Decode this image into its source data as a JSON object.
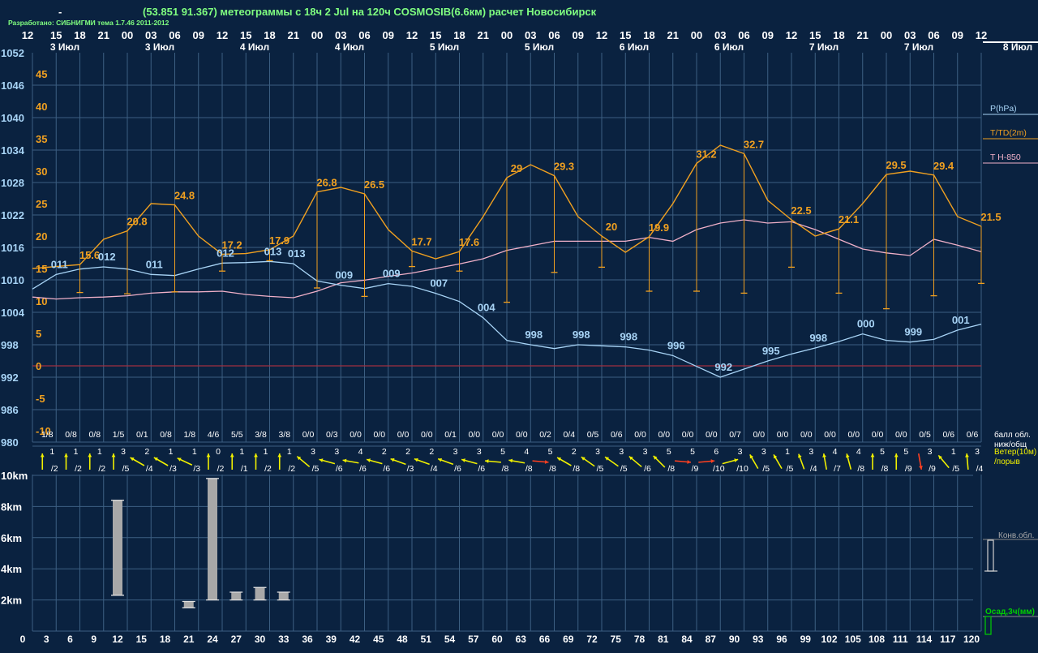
{
  "header": {
    "dash": "-",
    "title": "(53.851 91.367) метеограммы с  18ч 2 Jul на 120ч COSMOSIB(6.6км) расчет Новосибирск",
    "credit": "Разработано: СИБНИГМИ тема 1.7.46 2011-2012"
  },
  "colors": {
    "background": "#0a2240",
    "grid": "#3c5f82",
    "pressure": "#a8d4f6",
    "temperature": "#f0a020",
    "dewpoint_t850": "#f0b0c8",
    "zero_line": "#a03040",
    "wind_normal": "#f0f000",
    "wind_strong": "#ff4020",
    "cloud_bar": "#a8a8a8",
    "precip_legend": "#00d000",
    "text_white": "#ffffff",
    "title_green": "#80ff80"
  },
  "chart_data": {
    "type": "line",
    "hours_top": [
      "12",
      "15",
      "18",
      "21",
      "00",
      "03",
      "06",
      "09",
      "12",
      "15",
      "18",
      "21",
      "00",
      "03",
      "06",
      "09",
      "12",
      "15",
      "18",
      "21",
      "00",
      "03",
      "06",
      "09",
      "12",
      "15",
      "18",
      "21",
      "00",
      "03",
      "06",
      "09",
      "12",
      "15",
      "18",
      "21",
      "00",
      "03",
      "06",
      "09",
      "12"
    ],
    "day_labels": [
      "3 Июл",
      "3 Июл",
      "4 Июл",
      "4 Июл",
      "5 Июл",
      "5 Июл",
      "6 Июл",
      "6 Июл",
      "7 Июл",
      "7 Июл",
      "8 Июл"
    ],
    "forecast_hours": [
      "0",
      "3",
      "6",
      "9",
      "12",
      "15",
      "18",
      "21",
      "24",
      "27",
      "30",
      "33",
      "36",
      "39",
      "42",
      "45",
      "48",
      "51",
      "54",
      "57",
      "60",
      "63",
      "66",
      "69",
      "72",
      "75",
      "78",
      "81",
      "84",
      "87",
      "90",
      "93",
      "96",
      "99",
      "102",
      "105",
      "108",
      "111",
      "114",
      "117",
      "120"
    ],
    "pressure_axis_ticks": [
      "1052",
      "1046",
      "1040",
      "1034",
      "1028",
      "1022",
      "1016",
      "1010",
      "1004",
      "998",
      "992",
      "986",
      "980"
    ],
    "temp_axis_ticks": [
      "45",
      "40",
      "35",
      "30",
      "25",
      "20",
      "15",
      "10",
      "5",
      "0",
      "-5",
      "-10"
    ],
    "pressure_ylim": [
      980,
      1052
    ],
    "temp_ylim": [
      -10,
      48
    ],
    "series": [
      {
        "name": "P(hPa)",
        "values": [
          1008.3,
          1011,
          1012,
          1012.4,
          1012,
          1011,
          1010.8,
          1012,
          1013.1,
          1013.2,
          1013.4,
          1013,
          1009.8,
          1009,
          1008.4,
          1009.3,
          1008.8,
          1007.5,
          1006,
          1003,
          998.8,
          998,
          997.3,
          998,
          997.8,
          997.6,
          997,
          996,
          994,
          992,
          993.5,
          995,
          996.3,
          997.4,
          998.6,
          1000,
          998.8,
          998.5,
          999,
          1000.7,
          1001.8
        ]
      },
      {
        "name": "T/TD(2m)",
        "values": [
          15,
          15.3,
          15.6,
          19.5,
          20.8,
          25,
          24.8,
          20,
          17.2,
          17.3,
          17.9,
          20,
          26.8,
          27.5,
          26.5,
          21,
          17.7,
          16.5,
          17.6,
          23,
          29,
          31,
          29.3,
          23,
          20,
          17.5,
          19.9,
          25,
          31.2,
          34,
          32.7,
          25.5,
          22.5,
          20,
          21.1,
          25,
          29.5,
          30,
          29.4,
          23,
          21.5
        ]
      },
      {
        "name": "T H-850",
        "values": [
          10.6,
          10.3,
          10.5,
          10.6,
          10.8,
          11.2,
          11.4,
          11.4,
          11.5,
          11,
          10.7,
          10.5,
          11.5,
          12.8,
          13.2,
          13.8,
          14.3,
          15,
          15.7,
          16.5,
          17.8,
          18.5,
          19.2,
          19.2,
          19.2,
          19.2,
          19.8,
          19.2,
          21,
          22,
          22.5,
          22,
          22.2,
          21,
          19.5,
          18,
          17.4,
          17,
          19.5,
          18.6,
          17.6
        ]
      }
    ],
    "temp_point_labels": [
      {
        "i": 2,
        "text": "15.6"
      },
      {
        "i": 4,
        "text": "20.8"
      },
      {
        "i": 6,
        "text": "24.8"
      },
      {
        "i": 8,
        "text": "17.2"
      },
      {
        "i": 10,
        "text": "17.9"
      },
      {
        "i": 12,
        "text": "26.8"
      },
      {
        "i": 14,
        "text": "26.5"
      },
      {
        "i": 16,
        "text": "17.7"
      },
      {
        "i": 18,
        "text": "17.6"
      },
      {
        "i": 20,
        "text": "29"
      },
      {
        "i": 22,
        "text": "29.3"
      },
      {
        "i": 24,
        "text": "20"
      },
      {
        "i": 26,
        "text": "19.9"
      },
      {
        "i": 28,
        "text": "31.2"
      },
      {
        "i": 30,
        "text": "32.7"
      },
      {
        "i": 32,
        "text": "22.5"
      },
      {
        "i": 34,
        "text": "21.1"
      },
      {
        "i": 36,
        "text": "29.5"
      },
      {
        "i": 38,
        "text": "29.4"
      },
      {
        "i": 40,
        "text": "21.5"
      }
    ],
    "pressure_point_labels": [
      {
        "i": 1,
        "text": "011"
      },
      {
        "i": 3,
        "text": "012"
      },
      {
        "i": 5,
        "text": "011"
      },
      {
        "i": 8,
        "text": "012"
      },
      {
        "i": 10,
        "text": "013"
      },
      {
        "i": 11,
        "text": "013"
      },
      {
        "i": 13,
        "text": "009"
      },
      {
        "i": 15,
        "text": "009"
      },
      {
        "i": 17,
        "text": "007"
      },
      {
        "i": 19,
        "text": "004"
      },
      {
        "i": 21,
        "text": "998"
      },
      {
        "i": 23,
        "text": "998"
      },
      {
        "i": 25,
        "text": "998"
      },
      {
        "i": 27,
        "text": "996"
      },
      {
        "i": 29,
        "text": "992"
      },
      {
        "i": 31,
        "text": "995"
      },
      {
        "i": 33,
        "text": "998"
      },
      {
        "i": 35,
        "text": "000"
      },
      {
        "i": 37,
        "text": "999"
      },
      {
        "i": 39,
        "text": "001"
      }
    ],
    "td_whisker_bottom": [
      null,
      null,
      11.3,
      null,
      11.1,
      null,
      11.4,
      null,
      14.6,
      null,
      16.2,
      null,
      12,
      null,
      10.7,
      null,
      15.3,
      null,
      14.6,
      null,
      9.8,
      null,
      14.4,
      null,
      15.2,
      null,
      11.5,
      null,
      11.5,
      null,
      11.2,
      null,
      15.2,
      null,
      11.2,
      null,
      8.8,
      null,
      10.8,
      null,
      12.7
    ],
    "cloud_fractions": [
      "1/8",
      "0/8",
      "0/8",
      "1/5",
      "0/1",
      "0/8",
      "1/8",
      "4/6",
      "5/5",
      "3/8",
      "3/8",
      "0/0",
      "0/3",
      "0/0",
      "0/0",
      "0/0",
      "0/0",
      "0/1",
      "0/0",
      "0/0",
      "0/0",
      "0/2",
      "0/4",
      "0/5",
      "0/6",
      "0/0",
      "0/0",
      "0/0",
      "0/0",
      "0/7",
      "0/0",
      "0/0",
      "0/0",
      "0/0",
      "0/0",
      "0/0",
      "0/0",
      "0/5",
      "0/6",
      "0/6"
    ],
    "wind_speed": [
      "1",
      "1",
      "1",
      "3",
      "2",
      "1",
      "1",
      "0",
      "1",
      "1",
      "1",
      "3",
      "3",
      "4",
      "2",
      "2",
      "2",
      "3",
      "3",
      "5",
      "4",
      "5",
      "2",
      "3",
      "3",
      "3",
      "5",
      "5",
      "6",
      "3",
      "3",
      "1",
      "3",
      "4",
      "4",
      "5",
      "5",
      "3",
      "1",
      "3"
    ],
    "wind_gust": [
      "/2",
      "/2",
      "/2",
      "/5",
      "/4",
      "/3",
      "/3",
      "/2",
      "/1",
      "/2",
      "/2",
      "/5",
      "/6",
      "/6",
      "/6",
      "/3",
      "/4",
      "/6",
      "/6",
      "/8",
      "/8",
      "/8",
      "/8",
      "/5",
      "/5",
      "/6",
      "/8",
      "/9",
      "/10",
      "/10",
      "/5",
      "/5",
      "/4",
      "/7",
      "/8",
      "/8",
      "/9",
      "/9",
      "/5",
      "/4"
    ],
    "wind_dir_deg": [
      0,
      0,
      0,
      0,
      300,
      300,
      295,
      0,
      0,
      0,
      0,
      310,
      285,
      280,
      285,
      290,
      290,
      290,
      285,
      275,
      280,
      95,
      300,
      305,
      305,
      310,
      315,
      95,
      85,
      75,
      330,
      330,
      340,
      350,
      345,
      360,
      360,
      170,
      320,
      355
    ],
    "wind_strong": [
      false,
      false,
      false,
      false,
      false,
      false,
      false,
      false,
      false,
      false,
      false,
      false,
      false,
      false,
      false,
      false,
      false,
      false,
      false,
      false,
      false,
      true,
      false,
      false,
      false,
      false,
      false,
      true,
      true,
      false,
      false,
      false,
      false,
      false,
      false,
      false,
      false,
      true,
      false,
      false
    ],
    "cloud_axis_ticks": [
      "10km",
      "8km",
      "6km",
      "4km",
      "2km"
    ],
    "convective_clouds": [
      {
        "i": 4,
        "base_km": 2.3,
        "top_km": 8.4
      },
      {
        "i": 7,
        "base_km": 1.5,
        "top_km": 1.9
      },
      {
        "i": 8,
        "base_km": 2.0,
        "top_km": 9.8
      },
      {
        "i": 9,
        "base_km": 2.0,
        "top_km": 2.5
      },
      {
        "i": 10,
        "base_km": 2.0,
        "top_km": 2.8
      },
      {
        "i": 11,
        "base_km": 2.0,
        "top_km": 2.5
      }
    ],
    "legend": {
      "pressure": "P(hPa)",
      "temperature": "T/TD(2m)",
      "t850": "T H-850",
      "cloud_fraction": "балл обл.\nниж/общ",
      "wind": "Ветер(10м)\n/порыв",
      "convective": "Конв.обл.",
      "precip": "Осад,3ч(мм)"
    }
  }
}
